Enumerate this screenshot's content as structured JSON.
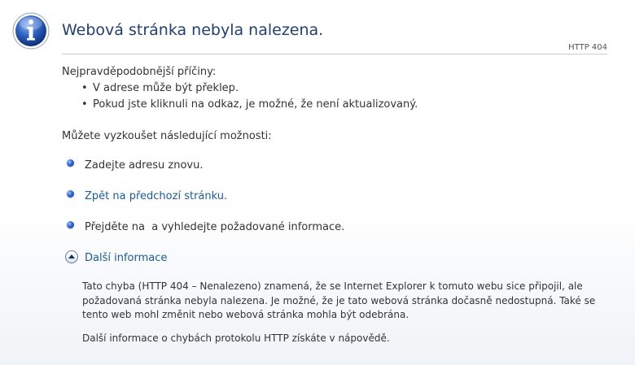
{
  "header": {
    "title": "Webová stránka nebyla nalezena.",
    "http_code": "HTTP 404"
  },
  "causes": {
    "heading": "Nejpravděpodobnější příčiny:",
    "items": [
      "V adrese může být překlep.",
      "Pokud jste kliknuli na odkaz, je možné, že není aktualizovaný."
    ]
  },
  "options": {
    "heading": "Můžete vyzkoušet následující možnosti:",
    "retype": "Zadejte adresu znovu.",
    "back_link": "Zpět na předchozí stránku.",
    "search": "Přejděte na  a vyhledejte požadované informace."
  },
  "more_info": {
    "label": "Další informace",
    "paragraph1": "Tato chyba (HTTP 404 – Nenalezeno) znamená, že se Internet Explorer k tomuto webu sice připojil, ale požadovaná stránka nebyla nalezena. Je možné, že je tato webová stránka dočasně nedostupná. Také se tento web mohl změnit nebo webová stránka mohla být odebrána.",
    "paragraph2": "Další informace o chybách protokolu HTTP získáte v nápovědě."
  },
  "colors": {
    "title": "#1f3f77",
    "link": "#1a5aa6",
    "bullet": "#2a63d6"
  },
  "icons": [
    "info-icon",
    "bullet-icon",
    "collapse-icon"
  ]
}
